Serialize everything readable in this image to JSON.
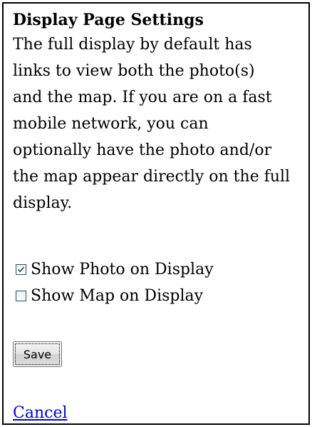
{
  "settings": {
    "title": "Display Page Settings",
    "description_lines": [
      "The full display by default has",
      "links to view both the photo(s)",
      "and the map. If you are on a fast",
      "mobile network, you can",
      "optionally have the photo and/or",
      "the map appear directly on the full",
      "display."
    ],
    "options": [
      {
        "label": "Show Photo on Display",
        "checked": true
      },
      {
        "label": "Show Map on Display",
        "checked": false
      }
    ],
    "save_label": "Save",
    "cancel_label": "Cancel"
  },
  "colors": {
    "link": "#0000ee",
    "checkbox_border": "#1c5180",
    "checkmark": "#2a6a2a"
  }
}
